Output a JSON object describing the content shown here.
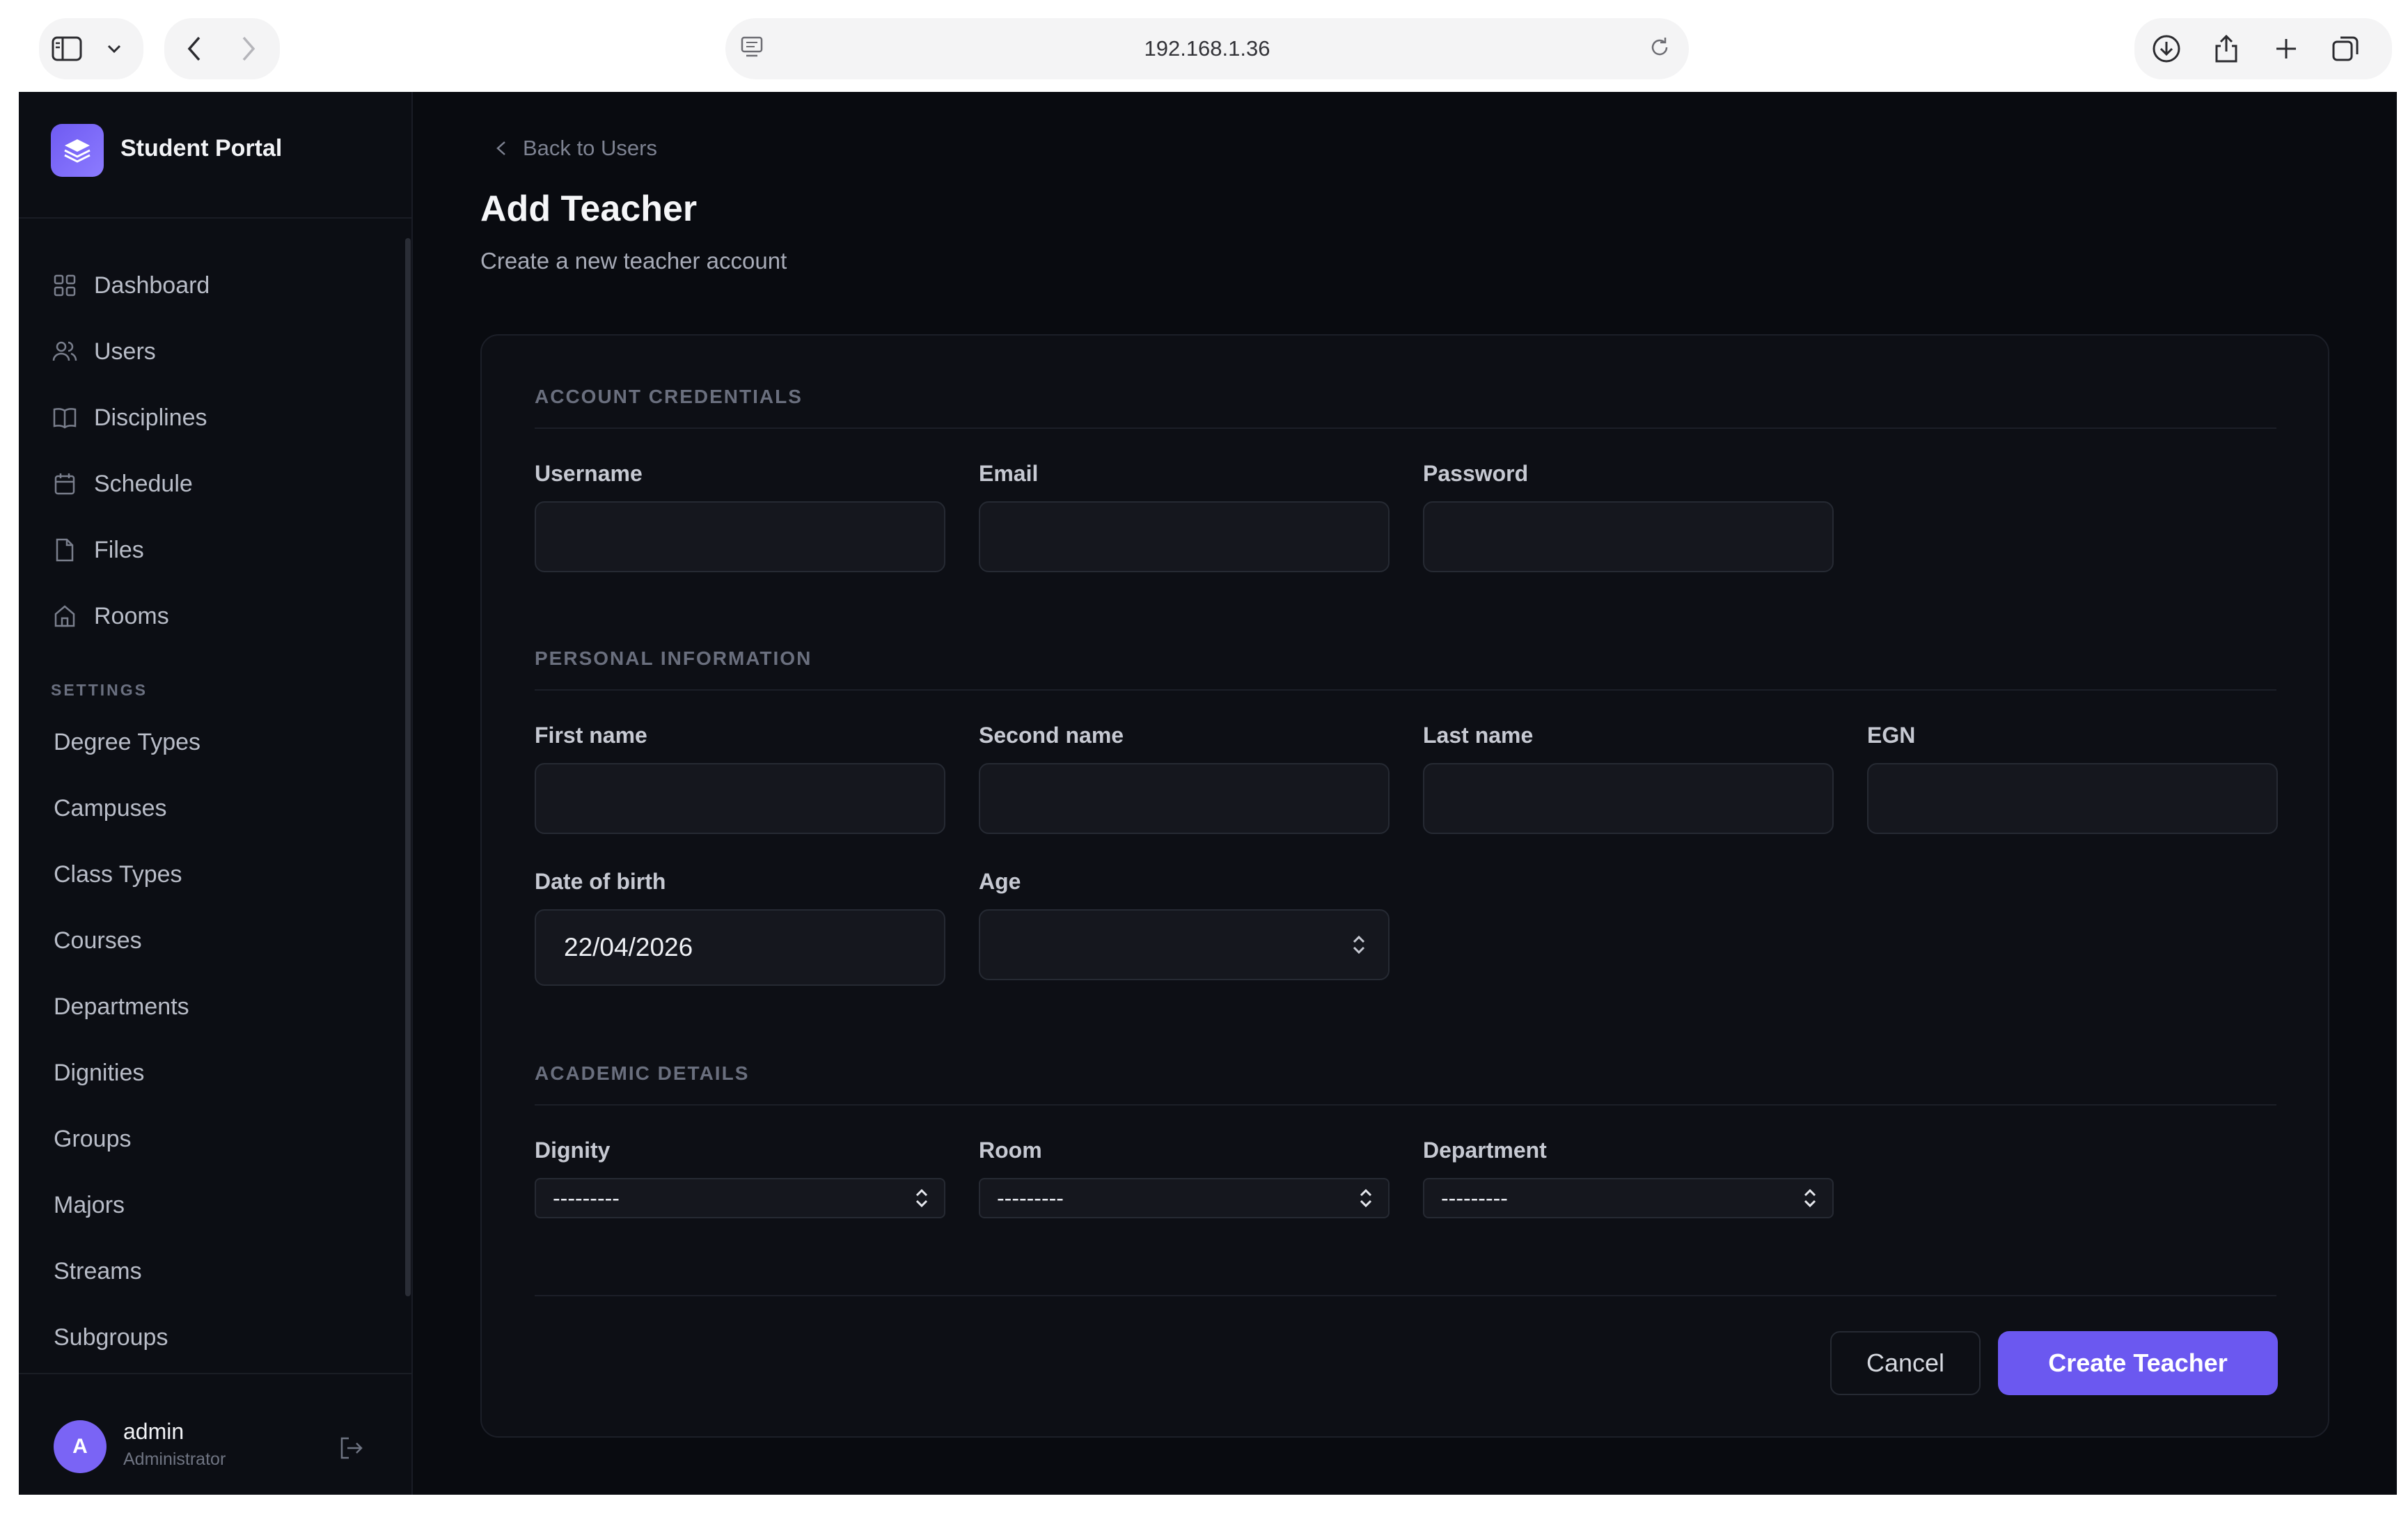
{
  "browser": {
    "url": "192.168.1.36"
  },
  "sidebar": {
    "brand": "Student Portal",
    "nav": [
      {
        "label": "Dashboard",
        "icon": "grid-icon"
      },
      {
        "label": "Users",
        "icon": "users-icon"
      },
      {
        "label": "Disciplines",
        "icon": "book-icon"
      },
      {
        "label": "Schedule",
        "icon": "calendar-icon"
      },
      {
        "label": "Files",
        "icon": "file-icon"
      },
      {
        "label": "Rooms",
        "icon": "home-icon"
      }
    ],
    "settings_label": "SETTINGS",
    "settings_items": [
      "Degree Types",
      "Campuses",
      "Class Types",
      "Courses",
      "Departments",
      "Dignities",
      "Groups",
      "Majors",
      "Streams",
      "Subgroups"
    ],
    "user": {
      "initial": "A",
      "name": "admin",
      "role": "Administrator"
    }
  },
  "main": {
    "back_link": "Back to Users",
    "title": "Add Teacher",
    "subtitle": "Create a new teacher account",
    "sections": {
      "account": {
        "title": "ACCOUNT CREDENTIALS",
        "username_label": "Username",
        "username_value": "",
        "email_label": "Email",
        "email_value": "",
        "password_label": "Password",
        "password_value": ""
      },
      "personal": {
        "title": "PERSONAL INFORMATION",
        "first_name_label": "First name",
        "first_name_value": "",
        "second_name_label": "Second name",
        "second_name_value": "",
        "last_name_label": "Last name",
        "last_name_value": "",
        "egn_label": "EGN",
        "egn_value": "",
        "dob_label": "Date of birth",
        "dob_value": "22/04/2026",
        "age_label": "Age",
        "age_value": ""
      },
      "academic": {
        "title": "ACADEMIC DETAILS",
        "dignity_label": "Dignity",
        "dignity_value": "---------",
        "room_label": "Room",
        "room_value": "---------",
        "department_label": "Department",
        "department_value": "---------"
      }
    },
    "cancel_label": "Cancel",
    "submit_label": "Create Teacher"
  },
  "colors": {
    "accent": "#6b58f0",
    "background": "#090b10",
    "sidebar": "#0c0e14"
  }
}
